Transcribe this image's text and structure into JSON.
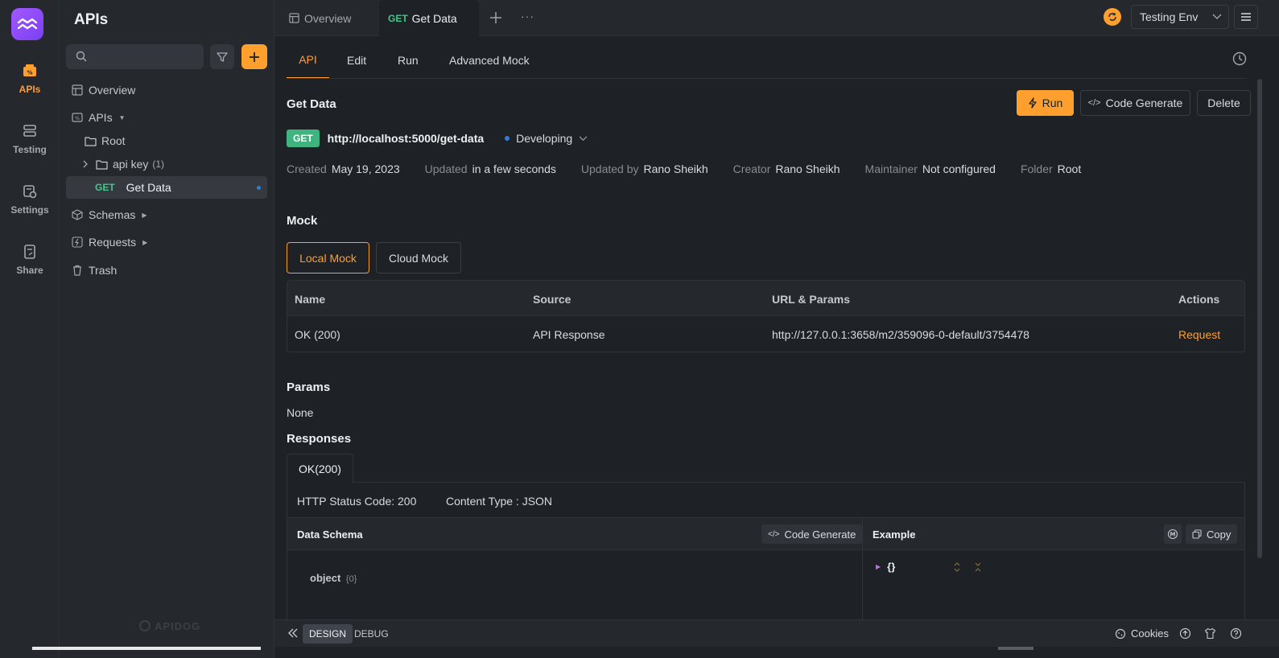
{
  "rail": {
    "items": [
      {
        "label": "APIs",
        "icon": "api-icon",
        "active": true
      },
      {
        "label": "Testing",
        "icon": "testing-icon"
      },
      {
        "label": "Settings",
        "icon": "settings-icon"
      },
      {
        "label": "Share",
        "icon": "share-icon"
      }
    ]
  },
  "sidebar": {
    "title": "APIs",
    "search_placeholder": "",
    "tree": {
      "overview": "Overview",
      "apis": "APIs",
      "root": "Root",
      "api_key": "api key",
      "api_key_count": "(1)",
      "get_method": "GET",
      "get_data": "Get Data",
      "schemas": "Schemas",
      "requests": "Requests",
      "trash": "Trash"
    },
    "watermark": "APIDOG"
  },
  "topbar": {
    "tabs": [
      {
        "label": "Overview"
      },
      {
        "method": "GET",
        "label": "Get Data",
        "active": true
      }
    ],
    "more": "···",
    "environment": "Testing Env"
  },
  "subtabs": [
    "API",
    "Edit",
    "Run",
    "Advanced Mock"
  ],
  "api": {
    "name": "Get Data",
    "method": "GET",
    "url": "http://localhost:5000/get-data",
    "status": "Developing",
    "buttons": {
      "run": "Run",
      "code_generate": "Code Generate",
      "delete": "Delete"
    },
    "meta": [
      {
        "label": "Created",
        "value": "May 19, 2023"
      },
      {
        "label": "Updated",
        "value": "in a few seconds"
      },
      {
        "label": "Updated by",
        "value": "Rano Sheikh"
      },
      {
        "label": "Creator",
        "value": "Rano Sheikh"
      },
      {
        "label": "Maintainer",
        "value": "Not configured"
      },
      {
        "label": "Folder",
        "value": "Root"
      }
    ]
  },
  "mock": {
    "title": "Mock",
    "tabs": [
      "Local Mock",
      "Cloud Mock"
    ],
    "columns": [
      "Name",
      "Source",
      "URL & Params",
      "Actions"
    ],
    "rows": [
      {
        "name": "OK (200)",
        "source": "API Response",
        "url": "http://127.0.0.1:3658/m2/359096-0-default/3754478",
        "action": "Request"
      }
    ]
  },
  "params": {
    "title": "Params",
    "value": "None"
  },
  "responses": {
    "title": "Responses",
    "tab": "OK(200)",
    "status_code": "HTTP Status Code: 200",
    "content_type": "Content Type : JSON",
    "schema_title": "Data Schema",
    "code_generate": "Code Generate",
    "schema_root": "object",
    "schema_count": "{0}",
    "example_title": "Example",
    "copy": "Copy",
    "example_json": "{}"
  },
  "bottombar": {
    "modes": [
      "DESIGN",
      "DEBUG"
    ],
    "cookies": "Cookies"
  },
  "colors": {
    "accent": "#ff9f2e",
    "get": "#3fb47f",
    "background": "#1e2126",
    "panel": "#25282d"
  }
}
